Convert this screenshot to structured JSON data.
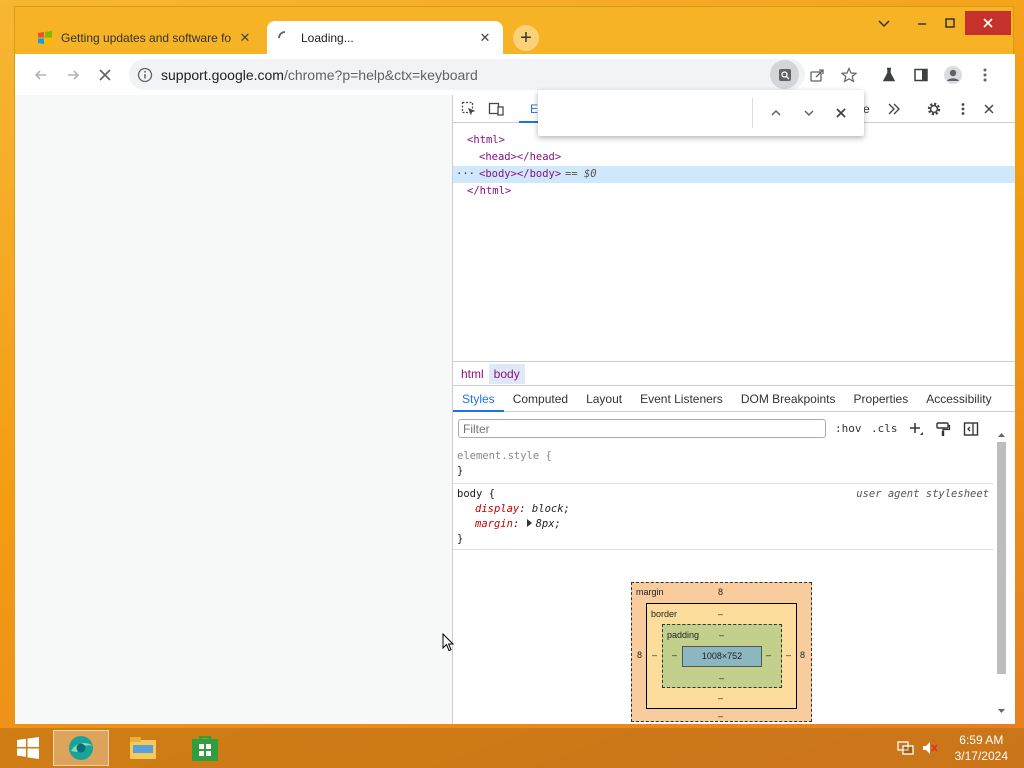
{
  "browser": {
    "tabs": [
      {
        "title": "Getting updates and software fo",
        "close": "✕"
      },
      {
        "title": "Loading...",
        "close": "✕"
      }
    ],
    "new_tab": "+",
    "url_host": "support.google.com",
    "url_path": "/chrome?p=help&ctx=keyboard"
  },
  "devtools": {
    "first_tab_label": "E",
    "clipped_tab_label": "e",
    "find_value": "",
    "dom": [
      {
        "text": "<html>"
      },
      {
        "text": "<head></head>"
      },
      {
        "text": "<body></body>",
        "suffix": " == $0",
        "dots": "···"
      },
      {
        "text": "</html>"
      }
    ],
    "breadcrumbs": [
      "html",
      "body"
    ],
    "subtabs": [
      "Styles",
      "Computed",
      "Layout",
      "Event Listeners",
      "DOM Breakpoints",
      "Properties",
      "Accessibility"
    ],
    "filter_placeholder": "Filter",
    "hov": ":hov",
    "cls": ".cls",
    "element_style": "element.style {",
    "close_brace": "}",
    "body_rule": {
      "selector": "body {",
      "source": "user agent stylesheet",
      "props": [
        {
          "name": "display",
          "value": "block;"
        },
        {
          "name": "margin",
          "value": "8px;"
        }
      ]
    },
    "box_model": {
      "margin_label": "margin",
      "margin_top": "8",
      "margin_left": "8",
      "margin_right": "8",
      "margin_bottom": "–",
      "border_label": "border",
      "border_top": "–",
      "border_left": "–",
      "border_right": "–",
      "border_bottom": "–",
      "padding_label": "padding",
      "padding_top": "–",
      "padding_left": "–",
      "padding_right": "–",
      "padding_bottom": "–",
      "content_size": "1008×752"
    }
  },
  "taskbar": {
    "time": "6:59 AM",
    "date": "3/17/2024"
  },
  "colors": {
    "accent": "#1a73e8",
    "desktop": "#f39c12",
    "close_button": "#c7312b"
  }
}
